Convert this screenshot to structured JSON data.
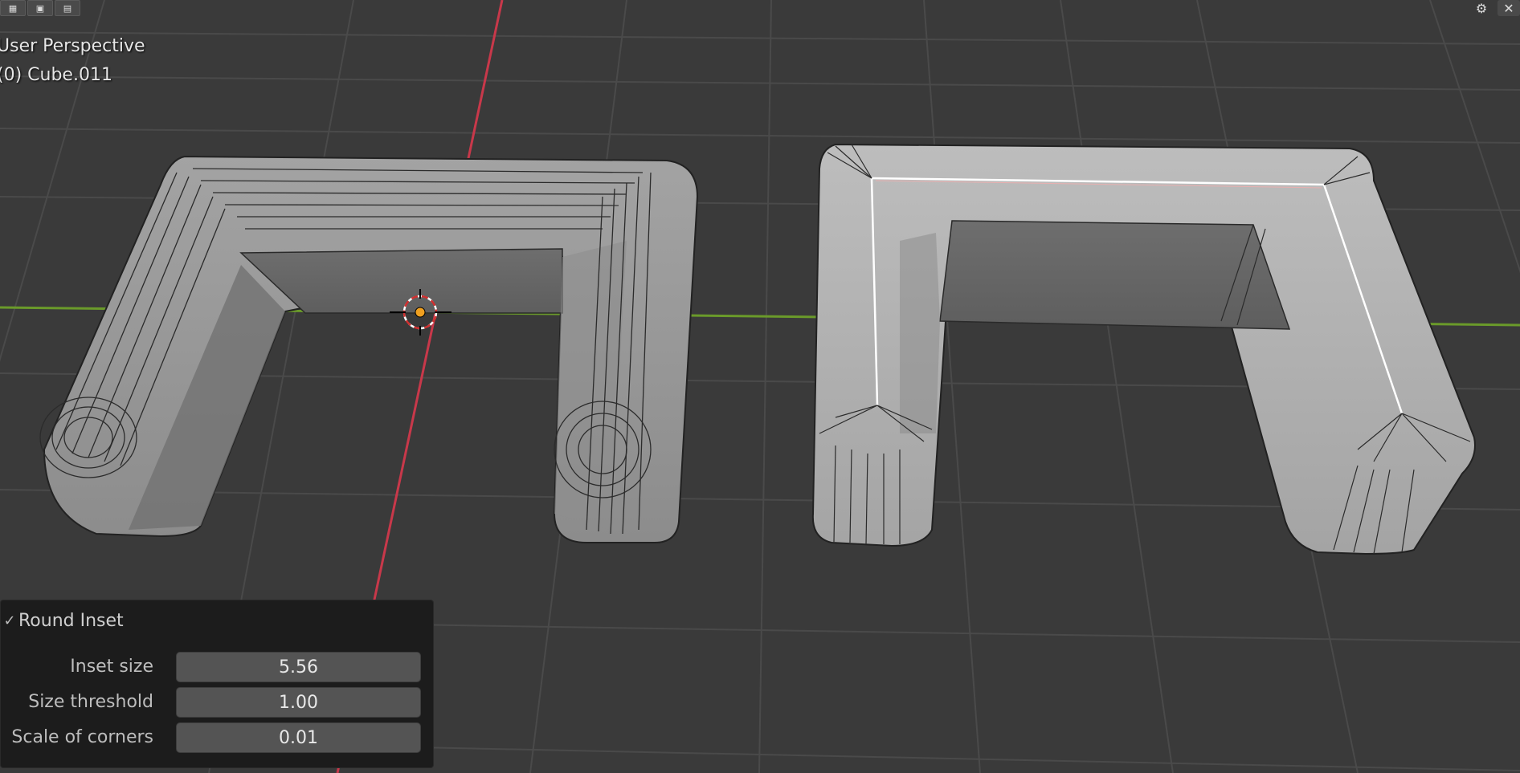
{
  "viewport": {
    "view_name": "User Perspective",
    "object_name": "(0) Cube.011"
  },
  "header": {
    "tools": [
      "select-box-icon",
      "select-extend-icon",
      "select-subtract-icon",
      "select-intersect-icon"
    ],
    "right_icons": [
      "gizmo-icon",
      "close-icon"
    ]
  },
  "operator_panel": {
    "title": "Round Inset",
    "fields": [
      {
        "label": "Inset size",
        "value": "5.56"
      },
      {
        "label": "Size threshold",
        "value": "1.00"
      },
      {
        "label": "Scale of corners",
        "value": "0.01"
      }
    ]
  },
  "colors": {
    "background": "#3a3a3a",
    "grid": "#4c4c4c",
    "x_axis": "#c8384a",
    "y_axis": "#6a9a2a",
    "mesh_left": "#8a8a8a",
    "mesh_right": "#a6a6a6",
    "cursor_accent": "#f0a020"
  }
}
